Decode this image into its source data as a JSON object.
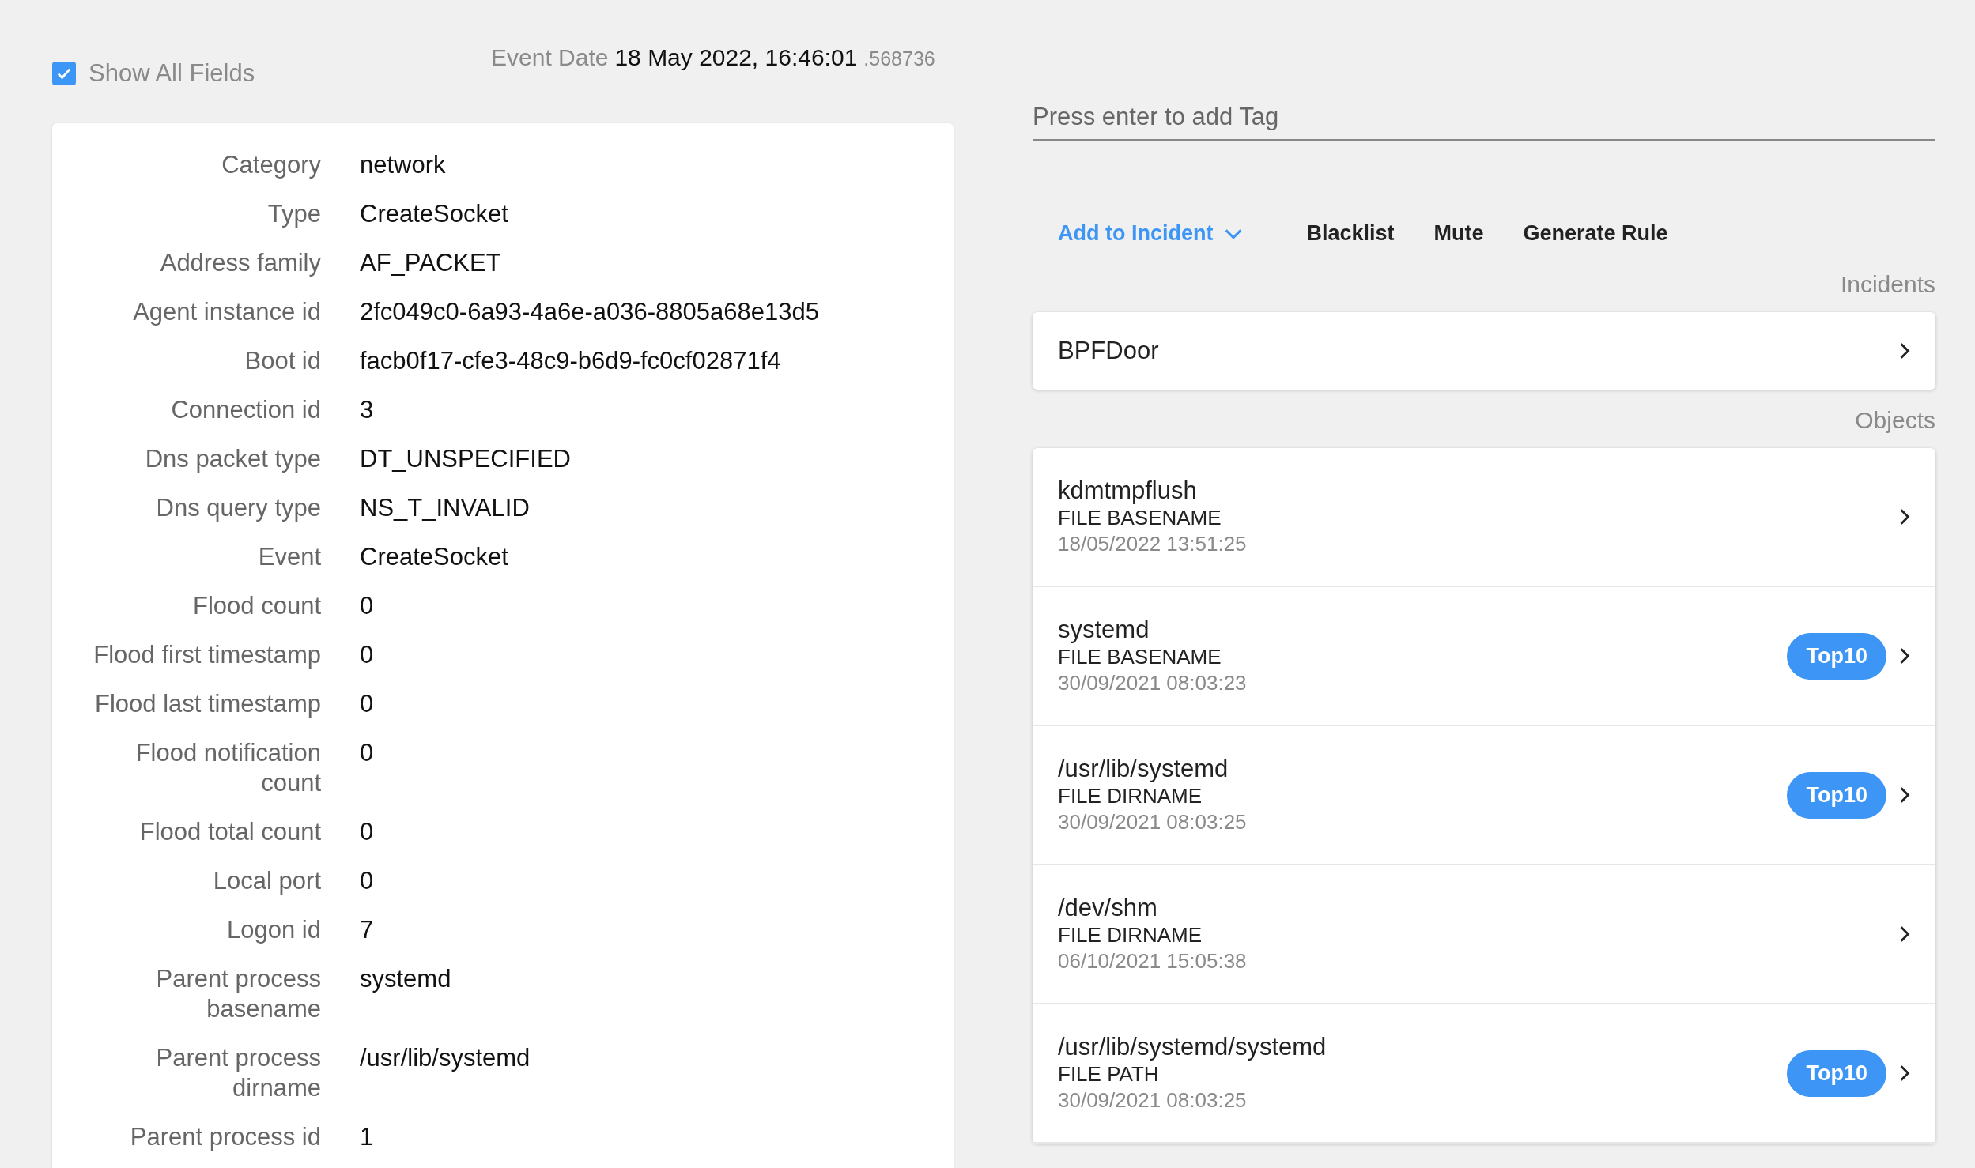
{
  "show_all_fields": {
    "label": "Show All Fields",
    "checked": true
  },
  "event_date": {
    "label": "Event Date",
    "value": "18 May 2022, 16:46:01",
    "fraction": ".568736"
  },
  "fields": [
    {
      "label": "Category",
      "value": "network"
    },
    {
      "label": "Type",
      "value": "CreateSocket"
    },
    {
      "label": "Address family",
      "value": "AF_PACKET"
    },
    {
      "label": "Agent instance id",
      "value": "2fc049c0-6a93-4a6e-a036-8805a68e13d5"
    },
    {
      "label": "Boot id",
      "value": "facb0f17-cfe3-48c9-b6d9-fc0cf02871f4"
    },
    {
      "label": "Connection id",
      "value": "3"
    },
    {
      "label": "Dns packet type",
      "value": "DT_UNSPECIFIED"
    },
    {
      "label": "Dns query type",
      "value": "NS_T_INVALID"
    },
    {
      "label": "Event",
      "value": "CreateSocket"
    },
    {
      "label": "Flood count",
      "value": "0"
    },
    {
      "label": "Flood first timestamp",
      "value": "0"
    },
    {
      "label": "Flood last timestamp",
      "value": "0"
    },
    {
      "label": "Flood notification count",
      "value": "0"
    },
    {
      "label": "Flood total count",
      "value": "0"
    },
    {
      "label": "Local port",
      "value": "0"
    },
    {
      "label": "Logon id",
      "value": "7"
    },
    {
      "label": "Parent process basename",
      "value": "systemd"
    },
    {
      "label": "Parent process dirname",
      "value": "/usr/lib/systemd"
    },
    {
      "label": "Parent process id",
      "value": "1"
    }
  ],
  "tag_field": {
    "placeholder": "Press enter to add Tag"
  },
  "actions": [
    {
      "label": "Add to Incident",
      "kind": "dropdown"
    },
    {
      "label": "Blacklist",
      "kind": "plain"
    },
    {
      "label": "Mute",
      "kind": "plain"
    },
    {
      "label": "Generate Rule",
      "kind": "plain"
    }
  ],
  "incidents": {
    "heading": "Incidents",
    "items": [
      {
        "name": "BPFDoor"
      }
    ]
  },
  "objects": {
    "heading": "Objects",
    "items": [
      {
        "name": "kdmtmpflush",
        "type": "FILE BASENAME",
        "date": "18/05/2022 13:51:25"
      },
      {
        "name": "systemd",
        "type": "FILE BASENAME",
        "date": "30/09/2021 08:03:23",
        "badge": "Top10"
      },
      {
        "name": "/usr/lib/systemd",
        "type": "FILE DIRNAME",
        "date": "30/09/2021 08:03:25",
        "badge": "Top10"
      },
      {
        "name": "/dev/shm",
        "type": "FILE DIRNAME",
        "date": "06/10/2021 15:05:38"
      },
      {
        "name": "/usr/lib/systemd/systemd",
        "type": "FILE PATH",
        "date": "30/09/2021 08:03:25",
        "badge": "Top10"
      }
    ]
  }
}
